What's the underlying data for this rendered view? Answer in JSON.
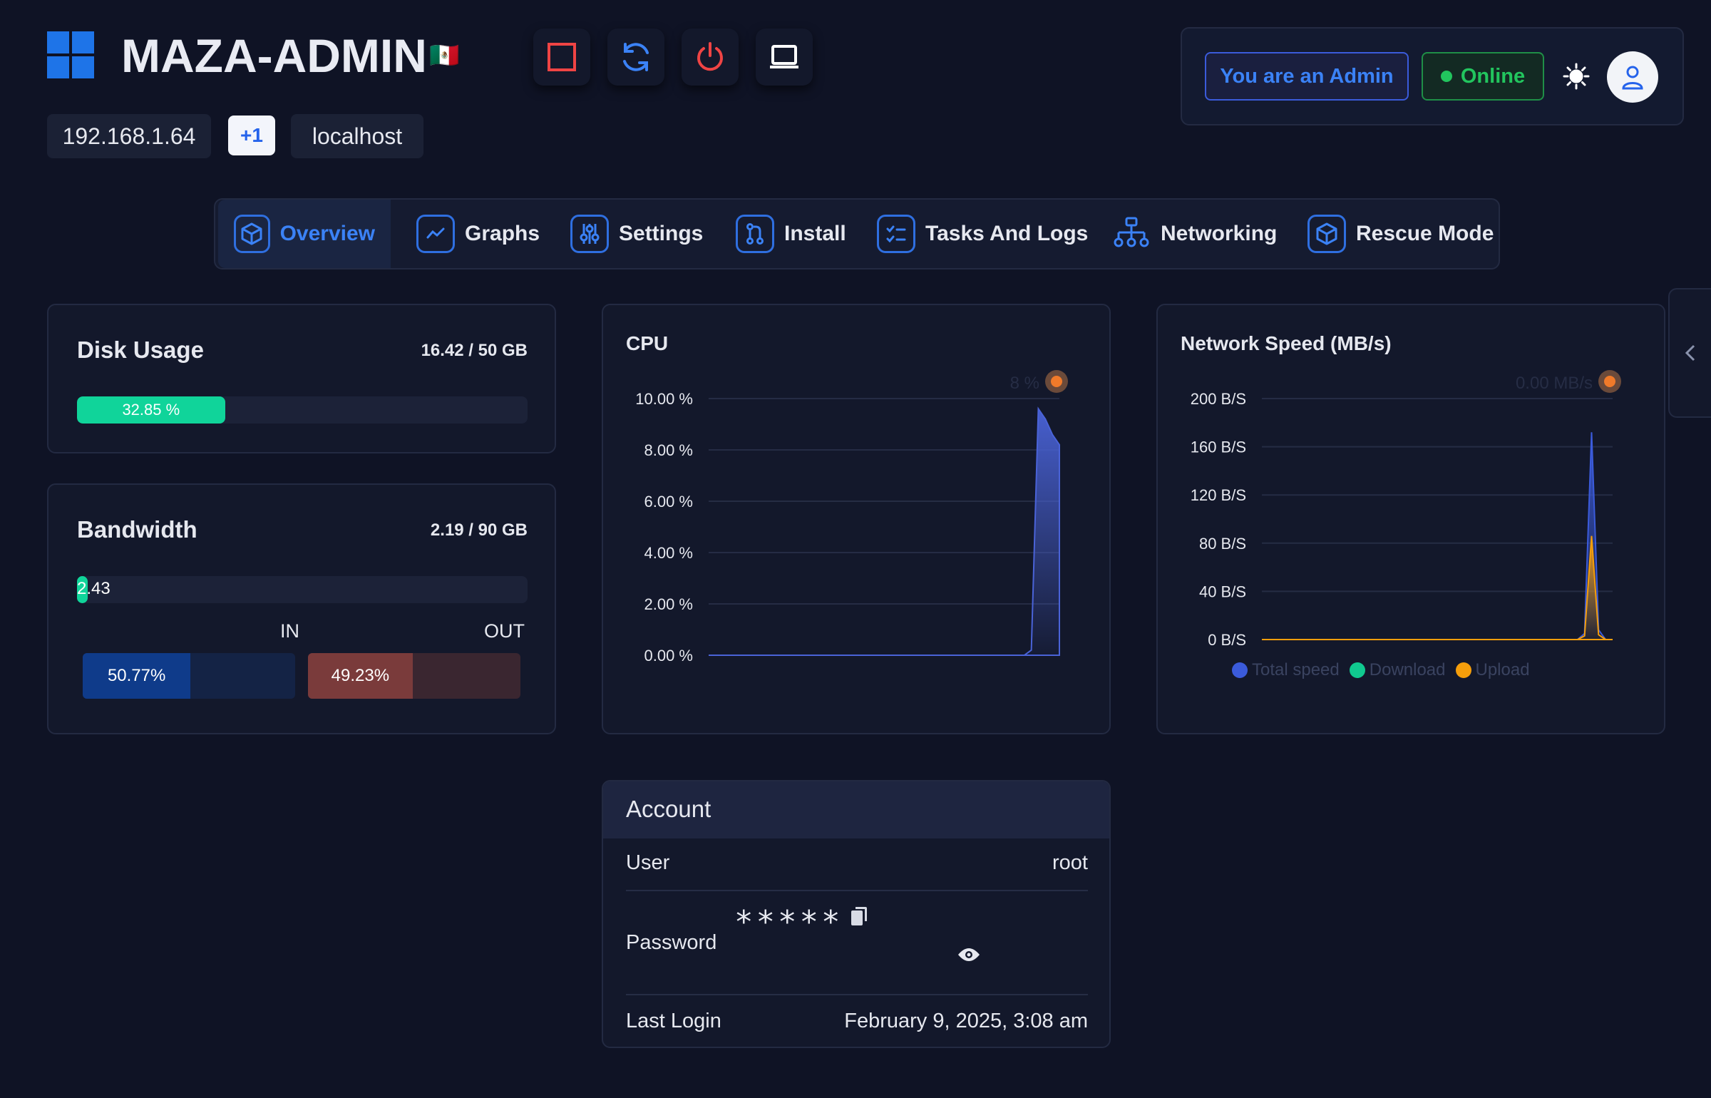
{
  "header": {
    "title": "MAZA-ADMIN",
    "flag": "🇲🇽",
    "ip": "192.168.1.64",
    "extra_count": "+1",
    "hostname": "localhost",
    "role_badge": "You are an Admin",
    "status": "Online",
    "colors": {
      "accent": "#3b82f6",
      "online": "#22c55e",
      "stop": "#ef4444"
    }
  },
  "actions": [
    "stop-icon",
    "refresh-icon",
    "power-icon",
    "console-icon"
  ],
  "tabs": [
    {
      "label": "Overview",
      "icon": "cube-icon",
      "active": true
    },
    {
      "label": "Graphs",
      "icon": "chart-icon"
    },
    {
      "label": "Settings",
      "icon": "sliders-icon"
    },
    {
      "label": "Install",
      "icon": "git-icon"
    },
    {
      "label": "Tasks And Logs",
      "icon": "checklist-icon"
    },
    {
      "label": "Networking",
      "icon": "network-icon"
    },
    {
      "label": "Rescue Mode",
      "icon": "cube-icon"
    }
  ],
  "disk": {
    "title": "Disk Usage",
    "summary": "16.42 / 50 GB",
    "percent_label": "32.85 %",
    "percent": 32.85
  },
  "bandwidth": {
    "title": "Bandwidth",
    "summary": "2.19 / 90 GB",
    "bar_label": "2.43",
    "percent": 2.43,
    "in_label": "IN",
    "out_label": "OUT",
    "in_percent_label": "50.77%",
    "in_percent": 50.77,
    "out_percent_label": "49.23%",
    "out_percent": 49.23
  },
  "cpu_title": "CPU",
  "cpu_hover": "8 %",
  "net_title": "Network Speed (MB/s)",
  "net_hover": "0.00 MB/s",
  "chart_data": [
    {
      "type": "area",
      "title": "CPU",
      "y_ticks": [
        "10.00 %",
        "8.00 %",
        "6.00 %",
        "4.00 %",
        "2.00 %",
        "0.00 %"
      ],
      "ylim": [
        0,
        10
      ],
      "series": [
        {
          "values": [
            0,
            0,
            0,
            0,
            0,
            0,
            0,
            0,
            0,
            0,
            0,
            0,
            0,
            0,
            0,
            0,
            0,
            0,
            0,
            0,
            0,
            0,
            0,
            0,
            0,
            0,
            0,
            0,
            0,
            0,
            0,
            0,
            0,
            0,
            0,
            0,
            0,
            0,
            0,
            0,
            0,
            0,
            0,
            0,
            0,
            0,
            0.2,
            9.6,
            9.2,
            8.6,
            8.2
          ]
        }
      ],
      "grid": true
    },
    {
      "type": "area",
      "title": "Network Speed (MB/s)",
      "y_ticks": [
        "200 B/S",
        "160 B/S",
        "120 B/S",
        "80 B/S",
        "40 B/S",
        "0 B/S"
      ],
      "ylim": [
        0,
        200
      ],
      "series": [
        {
          "name": "Total speed",
          "color": "#3b5bdb",
          "values": [
            0,
            0,
            0,
            0,
            0,
            0,
            0,
            0,
            0,
            0,
            0,
            0,
            0,
            0,
            0,
            0,
            0,
            0,
            0,
            0,
            0,
            0,
            0,
            0,
            0,
            0,
            0,
            0,
            0,
            0,
            0,
            0,
            0,
            0,
            0,
            0,
            0,
            0,
            0,
            0,
            0,
            0,
            0,
            0,
            0,
            0,
            5,
            172,
            8,
            0,
            0
          ]
        },
        {
          "name": "Download",
          "color": "#10c98f",
          "values": [
            0,
            0,
            0,
            0,
            0,
            0,
            0,
            0,
            0,
            0,
            0,
            0,
            0,
            0,
            0,
            0,
            0,
            0,
            0,
            0,
            0,
            0,
            0,
            0,
            0,
            0,
            0,
            0,
            0,
            0,
            0,
            0,
            0,
            0,
            0,
            0,
            0,
            0,
            0,
            0,
            0,
            0,
            0,
            0,
            0,
            0,
            0,
            0,
            0,
            0,
            0
          ]
        },
        {
          "name": "Upload",
          "color": "#f59e0b",
          "values": [
            0,
            0,
            0,
            0,
            0,
            0,
            0,
            0,
            0,
            0,
            0,
            0,
            0,
            0,
            0,
            0,
            0,
            0,
            0,
            0,
            0,
            0,
            0,
            0,
            0,
            0,
            0,
            0,
            0,
            0,
            0,
            0,
            0,
            0,
            0,
            0,
            0,
            0,
            0,
            0,
            0,
            0,
            0,
            0,
            0,
            0,
            3,
            86,
            4,
            0,
            0
          ]
        }
      ],
      "legend": "bottom",
      "grid": true
    }
  ],
  "account": {
    "title": "Account",
    "user_label": "User",
    "user_value": "root",
    "password_label": "Password",
    "password_value": "*****",
    "last_login_label": "Last Login",
    "last_login_value": "February 9, 2025, 3:08 am"
  }
}
